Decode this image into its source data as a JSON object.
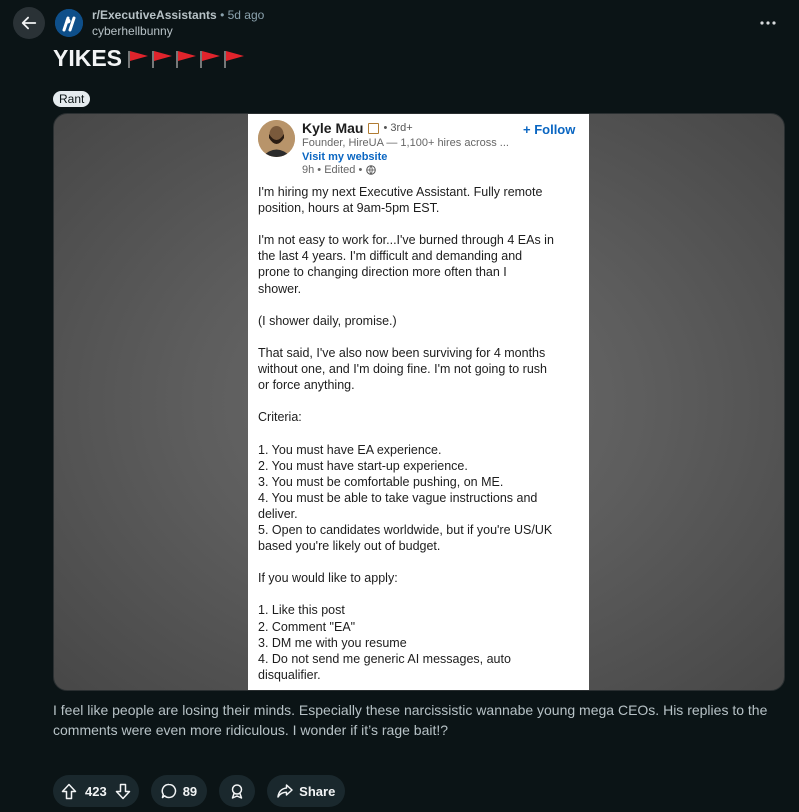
{
  "header": {
    "subreddit": "r/ExecutiveAssistants",
    "separator": "•",
    "age": "5d ago",
    "author": "cyberhellbunny"
  },
  "post": {
    "title": "YIKES",
    "flag_count": 5,
    "flag_color": "#e0242c",
    "flair": "Rant",
    "body": "I feel like people are losing their minds. Especially these narcissistic wannabe young mega CEOs. His replies to the comments were even more ridiculous. I wonder if it’s rage bait!?"
  },
  "screenshot": {
    "name": "Kyle Mau",
    "degree": "• 3rd+",
    "follow": "+ Follow",
    "headline": "Founder, HireUA — 1,100+ hires across ...",
    "link": "Visit my website",
    "time": "9h • Edited •",
    "paragraphs": [
      "I'm hiring my next Executive Assistant. Fully remote\nposition, hours at 9am-5pm EST.",
      "I'm not easy to work for...I've burned through 4 EAs in\nthe last 4 years. I'm difficult and demanding and\nprone to changing direction more often than I\nshower.",
      "(I shower daily, promise.)",
      "That said, I've also now been surviving for 4 months\nwithout one, and I'm doing fine. I'm not going to rush\nor force anything.",
      "Criteria:",
      "1. You must have EA experience.\n2. You must have start-up experience.\n3. You must be comfortable pushing, on ME.\n4. You must be able to take vague instructions and\ndeliver.\n5. Open to candidates worldwide, but if you're US/UK\nbased you're likely out of budget.",
      "If you would like to apply:",
      "1. Like this post\n2. Comment \"EA\"\n3. DM me with you resume\n4. Do not send me generic AI messages, auto\ndisqualifier."
    ]
  },
  "actions": {
    "upvotes": "423",
    "comments": "89",
    "share": "Share"
  },
  "icons": {
    "back": "back-arrow-icon",
    "more": "more-options-icon",
    "upvote": "upvote-arrow-icon",
    "downvote": "downvote-arrow-icon",
    "comment": "comment-bubble-icon",
    "award": "award-icon",
    "share": "share-arrow-icon"
  },
  "colors": {
    "background": "#0b1416",
    "pill": "#1a282d",
    "linkedin_blue": "#0a66c2"
  }
}
